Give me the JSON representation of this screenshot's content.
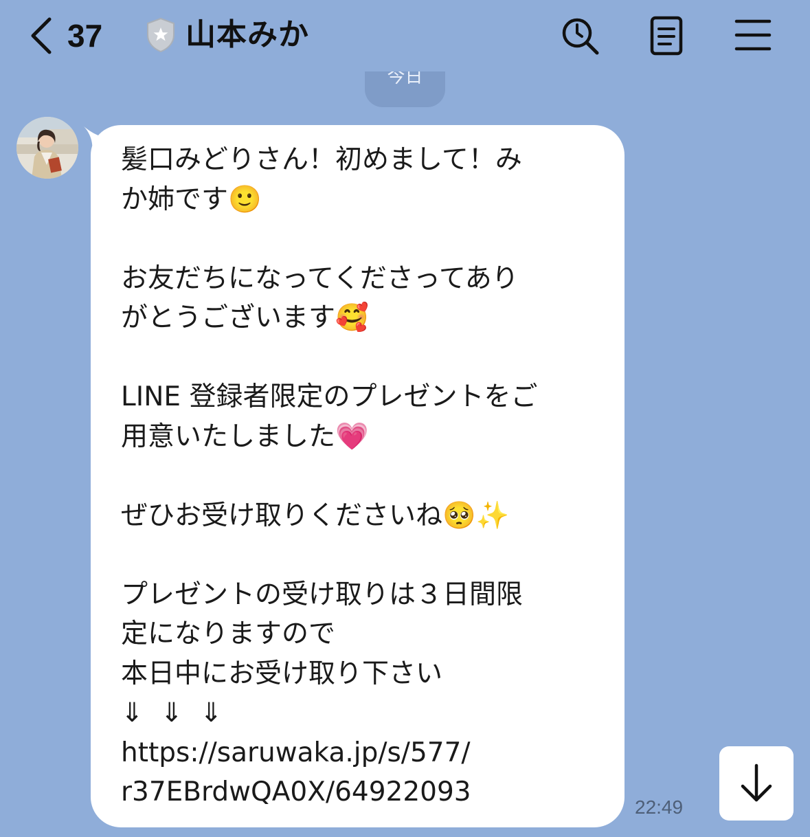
{
  "header": {
    "back_icon": "chevron-left-icon",
    "unread_count": "37",
    "badge_icon": "shield-star-icon",
    "contact_name": "山本みか",
    "actions": [
      {
        "icon": "search-icon"
      },
      {
        "icon": "notes-icon"
      },
      {
        "icon": "menu-icon"
      }
    ]
  },
  "date_label": "今日",
  "message": {
    "sender_avatar": "avatar-photo",
    "time": "22:49",
    "bubble_color": "#ffffff",
    "text": "髪口みどりさん！初めまして！み\nか姉です🙂\n\nお友だちになってくださってあり\nがとうございます🥰\n\nLINE 登録者限定のプレゼントをご\n用意いたしました💗\n\nぜひお受け取りくださいね🥺✨\n\nプレゼントの受け取りは３日間限\n定になりますので\n本日中にお受け取り下さい\n⇓  ⇓  ⇓\nhttps://saruwaka.jp/s/577/\nr37EBrdwQA0X/64922093"
  },
  "scroll_button": {
    "icon": "arrow-down-icon"
  },
  "colors": {
    "background": "#8fadd9",
    "date_pill": "#7f9cc8",
    "text": "#1a1a1a"
  }
}
